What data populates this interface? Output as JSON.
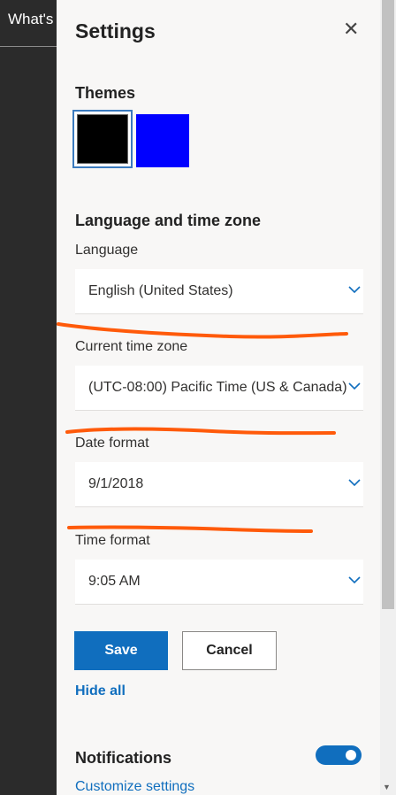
{
  "left_bar": {
    "text": "What's"
  },
  "panel": {
    "title": "Settings",
    "close_glyph": "✕",
    "themes": {
      "heading": "Themes",
      "swatches": [
        {
          "name": "black",
          "color": "#000000",
          "selected": true
        },
        {
          "name": "blue",
          "color": "#0000ff",
          "selected": false
        }
      ]
    },
    "language_section": {
      "heading": "Language and time zone",
      "language": {
        "label": "Language",
        "value": "English (United States)"
      },
      "time_zone": {
        "label": "Current time zone",
        "value": "(UTC-08:00) Pacific Time (US & Canada)"
      },
      "date_format": {
        "label": "Date format",
        "value": "9/1/2018"
      },
      "time_format": {
        "label": "Time format",
        "value": "9:05 AM"
      }
    },
    "buttons": {
      "save": "Save",
      "cancel": "Cancel"
    },
    "hide_all": "Hide all",
    "notifications": {
      "heading": "Notifications",
      "toggle_on": true,
      "customize_link": "Customize settings"
    }
  },
  "colors": {
    "accent": "#106ebe",
    "markup": "#ff5a0a",
    "sidebar": "#2b2b2b",
    "panel_bg": "#f8f7f6"
  }
}
